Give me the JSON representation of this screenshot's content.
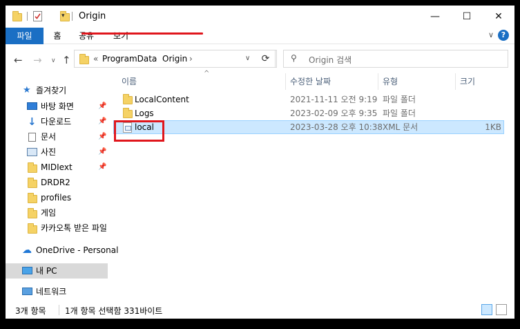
{
  "window": {
    "title": "Origin",
    "controls": {
      "minimize": "—",
      "maximize": "☐",
      "close": "✕"
    }
  },
  "ribbon": {
    "tabs": [
      "파일",
      "홈",
      "공유",
      "보기"
    ],
    "expand": "∨",
    "help": "?"
  },
  "address": {
    "overflow": "«",
    "crumbs": [
      "ProgramData",
      "Origin"
    ],
    "separator": "›",
    "dropdown": "∨"
  },
  "search": {
    "placeholder": "Origin 검색"
  },
  "sidebar": {
    "quick_access": "즐겨찾기",
    "items": [
      "바탕 화면",
      "다운로드",
      "문서",
      "사진",
      "MIDIext",
      "DRDR2",
      "profiles",
      "게임",
      "카카오톡 받은 파일"
    ],
    "onedrive": "OneDrive - Personal",
    "this_pc": "내 PC",
    "network": "네트워크"
  },
  "columns": {
    "name": "이름",
    "date": "수정한 날짜",
    "type": "유형",
    "size": "크기"
  },
  "files": [
    {
      "name": "LocalContent",
      "date": "2021-11-11 오전 9:19",
      "type": "파일 폴더",
      "size": "",
      "icon": "folder-icon"
    },
    {
      "name": "Logs",
      "date": "2023-02-09 오후 9:35",
      "type": "파일 폴더",
      "size": "",
      "icon": "folder-icon"
    },
    {
      "name": "local",
      "date": "2023-03-28 오후 10:38",
      "type": "XML 문서",
      "size": "1KB",
      "icon": "xml-file-icon"
    }
  ],
  "status": {
    "item_count": "3개 항목",
    "selection": "1개 항목 선택함 331바이트"
  },
  "colors": {
    "accent": "#1a6fc4",
    "selection": "#cce8ff",
    "highlight": "#e0161c"
  }
}
